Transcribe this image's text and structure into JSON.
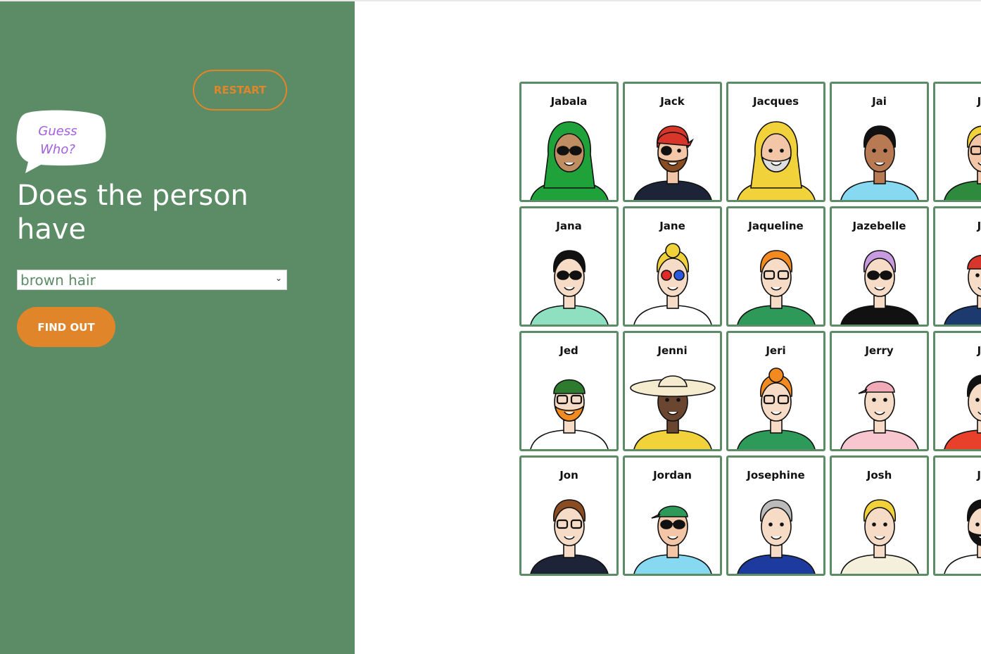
{
  "app": {
    "restart_label": "RESTART",
    "logo_text": [
      "Guess",
      "Who?"
    ],
    "question": "Does the person have",
    "select_value": "brown hair",
    "find_out_label": "FIND OUT"
  },
  "colors": {
    "sidebar": "#5c8c66",
    "accent_orange": "#e0852a",
    "logo_purple": "#a25fe0",
    "card_border": "#5c8c66"
  },
  "cards": [
    {
      "name": "Jabala",
      "skin": "#c08c62",
      "hair": "#1fa23a",
      "shirt": "#1fa23a",
      "glasses": "sunglasses",
      "hat": "hijab",
      "beard": false
    },
    {
      "name": "Jack",
      "skin": "#f2c6a6",
      "hair": "#d9362b",
      "shirt": "#1d2438",
      "glasses": "eyepatch",
      "hat": "bandana",
      "beard": true,
      "beard_color": "#8a4c22"
    },
    {
      "name": "Jacques",
      "skin": "#f2c6a6",
      "hair": "#f2d23a",
      "shirt": "#f2d23a",
      "glasses": "none",
      "hat": "raincoat",
      "beard": true,
      "beard_color": "#dddddd"
    },
    {
      "name": "Jai",
      "skin": "#b87a52",
      "hair": "#111111",
      "shirt": "#86d9f0",
      "glasses": "none",
      "hat": "none",
      "beard": false
    },
    {
      "name": "Ja",
      "skin": "#f2c6a6",
      "hair": "#f2d23a",
      "shirt": "#2e8b3e",
      "glasses": "glasses",
      "hat": "none",
      "beard": false
    },
    {
      "name": "Jana",
      "skin": "#f6dcc6",
      "hair": "#111111",
      "shirt": "#8fe0c0",
      "glasses": "sunglasses",
      "hat": "none",
      "beard": false
    },
    {
      "name": "Jane",
      "skin": "#f6dcc6",
      "hair": "#f2d23a",
      "shirt": "#ffffff",
      "glasses": "3d",
      "hat": "bun",
      "beard": false
    },
    {
      "name": "Jaqueline",
      "skin": "#f6dcc6",
      "hair": "#f28a1f",
      "shirt": "#2e9a5a",
      "glasses": "glasses",
      "hat": "none",
      "beard": false
    },
    {
      "name": "Jazebelle",
      "skin": "#f6dcc6",
      "hair": "#c89ae0",
      "shirt": "#111111",
      "glasses": "sunglasses",
      "hat": "none",
      "beard": false
    },
    {
      "name": "Je",
      "skin": "#f6dcc6",
      "hair": "#d9362b",
      "shirt": "#1d3a6e",
      "glasses": "none",
      "hat": "beanie",
      "beard": false
    },
    {
      "name": "Jed",
      "skin": "#f6dcc6",
      "hair": "#2e7a2e",
      "shirt": "#ffffff",
      "glasses": "glasses",
      "hat": "beanie",
      "beard": true,
      "beard_color": "#f28a1f"
    },
    {
      "name": "Jenni",
      "skin": "#6a4630",
      "hair": "#f5ecd0",
      "shirt": "#f2d23a",
      "glasses": "none",
      "hat": "sunhat",
      "beard": false
    },
    {
      "name": "Jeri",
      "skin": "#f6dcc6",
      "hair": "#f28a1f",
      "shirt": "#2e9a5a",
      "glasses": "glasses",
      "hat": "bun",
      "beard": false
    },
    {
      "name": "Jerry",
      "skin": "#f6dcc6",
      "hair": "#f2aab8",
      "shirt": "#f7c6cf",
      "glasses": "none",
      "hat": "cap",
      "beard": false
    },
    {
      "name": "Je",
      "skin": "#f6dcc6",
      "hair": "#111111",
      "shirt": "#e8402a",
      "glasses": "none",
      "hat": "none",
      "beard": false
    },
    {
      "name": "Jon",
      "skin": "#f6dcc6",
      "hair": "#8a4c22",
      "shirt": "#1d2438",
      "glasses": "glasses",
      "hat": "none",
      "beard": false
    },
    {
      "name": "Jordan",
      "skin": "#f2c6a6",
      "hair": "#2e9a5a",
      "shirt": "#86d9f0",
      "glasses": "sunglasses",
      "hat": "cap",
      "beard": false
    },
    {
      "name": "Josephine",
      "skin": "#f6dcc6",
      "hair": "#bbbbbb",
      "shirt": "#1d3a9e",
      "glasses": "none",
      "hat": "none",
      "beard": false
    },
    {
      "name": "Josh",
      "skin": "#f6dcc6",
      "hair": "#f2d23a",
      "shirt": "#f5f0dc",
      "glasses": "none",
      "hat": "none",
      "beard": false
    },
    {
      "name": "Ju",
      "skin": "#f6dcc6",
      "hair": "#111111",
      "shirt": "#ffffff",
      "glasses": "none",
      "hat": "none",
      "beard": true,
      "beard_color": "#111111"
    }
  ]
}
